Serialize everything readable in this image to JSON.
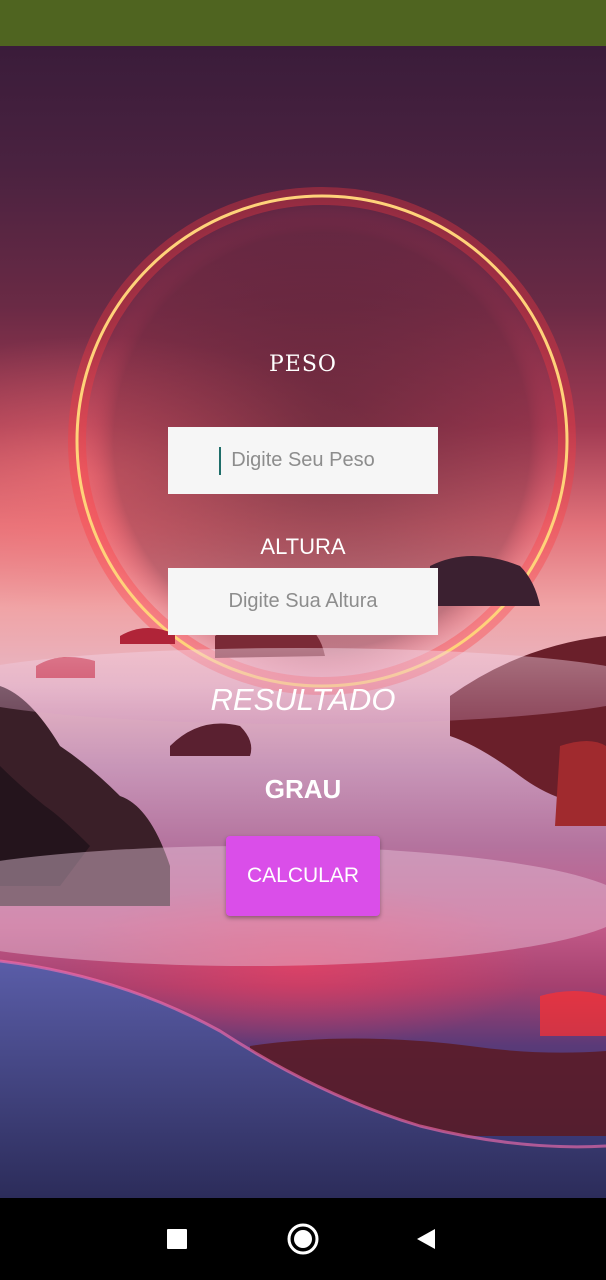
{
  "status_bar": {
    "color": "#4f6420"
  },
  "form": {
    "peso_label": "PESO",
    "peso_placeholder": "Digite Seu Peso",
    "altura_label": "ALTURA",
    "altura_placeholder": "Digite Sua Altura",
    "resultado_label": "RESULTADO",
    "grau_label": "GRAU",
    "calcular_label": "CALCULAR"
  },
  "colors": {
    "button": "#da4ee9",
    "field_bg": "#f6f6f6"
  },
  "nav_bar": {
    "icons": [
      "square-recents-icon",
      "circle-home-icon",
      "triangle-back-icon"
    ]
  }
}
